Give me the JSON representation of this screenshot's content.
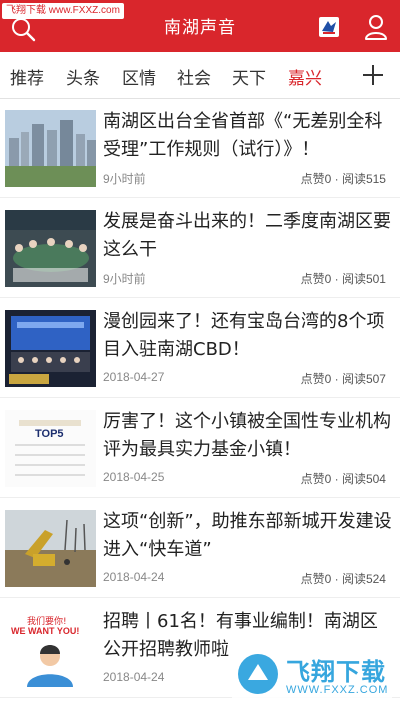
{
  "watermark_top": "飞翔下载 www.FXXZ.com",
  "header": {
    "title": "南湖声音",
    "logo_icon": "app-logo-icon",
    "search_icon": "search-icon",
    "user_icon": "user-profile-icon"
  },
  "tabs": [
    {
      "label": "推荐",
      "active": false
    },
    {
      "label": "头条",
      "active": false
    },
    {
      "label": "区情",
      "active": false
    },
    {
      "label": "社会",
      "active": false
    },
    {
      "label": "天下",
      "active": false
    },
    {
      "label": "嘉兴",
      "active": true
    }
  ],
  "add_tab_icon": "plus-icon",
  "articles": [
    {
      "title": "南湖区出台全省首部《“无差别全科受理”工作规则（试行）》！",
      "time": "9小时前",
      "stats": "点赞0 · 阅读515"
    },
    {
      "title": "发展是奋斗出来的！二季度南湖区要这么干",
      "time": "9小时前",
      "stats": "点赞0 · 阅读501"
    },
    {
      "title": "漫创园来了！还有宝岛台湾的8个项目入驻南湖CBD！",
      "time": "2018-04-27",
      "stats": "点赞0 · 阅读507"
    },
    {
      "title": "厉害了！这个小镇被全国性专业机构评为最具实力基金小镇！",
      "time": "2018-04-25",
      "stats": "点赞0 · 阅读504"
    },
    {
      "title": "这项“创新”，助推东部新城开发建设进入“快车道”",
      "time": "2018-04-24",
      "stats": "点赞0 · 阅读524"
    },
    {
      "title": "招聘丨61名！有事业编制！南湖区公开招聘教师啦",
      "time": "2018-04-24",
      "stats": ""
    }
  ],
  "thumbnail_texts": {
    "article_4": "TOP5",
    "article_6_line1": "我们要你!",
    "article_6_line2": "WE WANT YOU!"
  },
  "watermark_bottom": {
    "text": "飞翔下载",
    "url": "WWW.FXXZ.COM"
  },
  "colors": {
    "brand_red": "#d9262c",
    "active_tab": "#d9262c",
    "watermark_blue": "#36a6de"
  }
}
